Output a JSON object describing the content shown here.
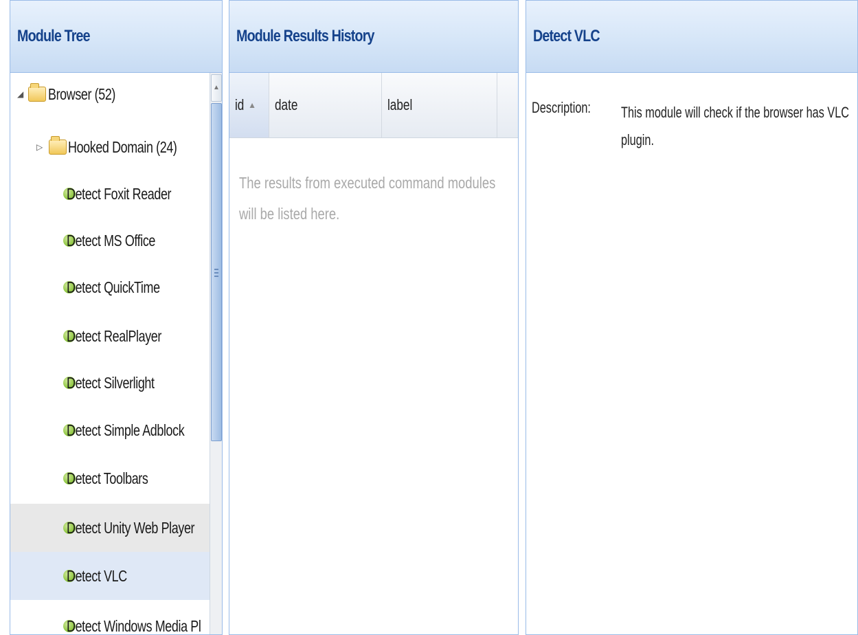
{
  "tree_panel": {
    "title": "Module Tree",
    "nodes": [
      {
        "label": "Browser (52)",
        "type": "folder",
        "expanded": true
      },
      {
        "label": "Hooked Domain (24)",
        "type": "folder",
        "expanded": false
      },
      {
        "label": "Detect Foxit Reader",
        "type": "module"
      },
      {
        "label": "Detect MS Office",
        "type": "module"
      },
      {
        "label": "Detect QuickTime",
        "type": "module"
      },
      {
        "label": "Detect RealPlayer",
        "type": "module"
      },
      {
        "label": "Detect Silverlight",
        "type": "module"
      },
      {
        "label": "Detect Simple Adblock",
        "type": "module"
      },
      {
        "label": "Detect Toolbars",
        "type": "module"
      },
      {
        "label": "Detect Unity Web Player",
        "type": "module",
        "state": "hover"
      },
      {
        "label": "Detect VLC",
        "type": "module",
        "state": "selected"
      },
      {
        "label": "Detect Windows Media Pl",
        "type": "module"
      }
    ]
  },
  "history_panel": {
    "title": "Module Results History",
    "columns": [
      "id",
      "date",
      "label"
    ],
    "sort_indicator": "▲",
    "empty_message": "The results from executed command modules will be listed here."
  },
  "detail_panel": {
    "title": "Detect VLC",
    "description_label": "Description:",
    "description_text": "This module will check if the browser has VLC plugin."
  },
  "colors": {
    "header_text": "#15428b",
    "panel_border": "#99bbe8",
    "selected_row": "#dfe8f6",
    "module_icon": "#8dc63f"
  }
}
